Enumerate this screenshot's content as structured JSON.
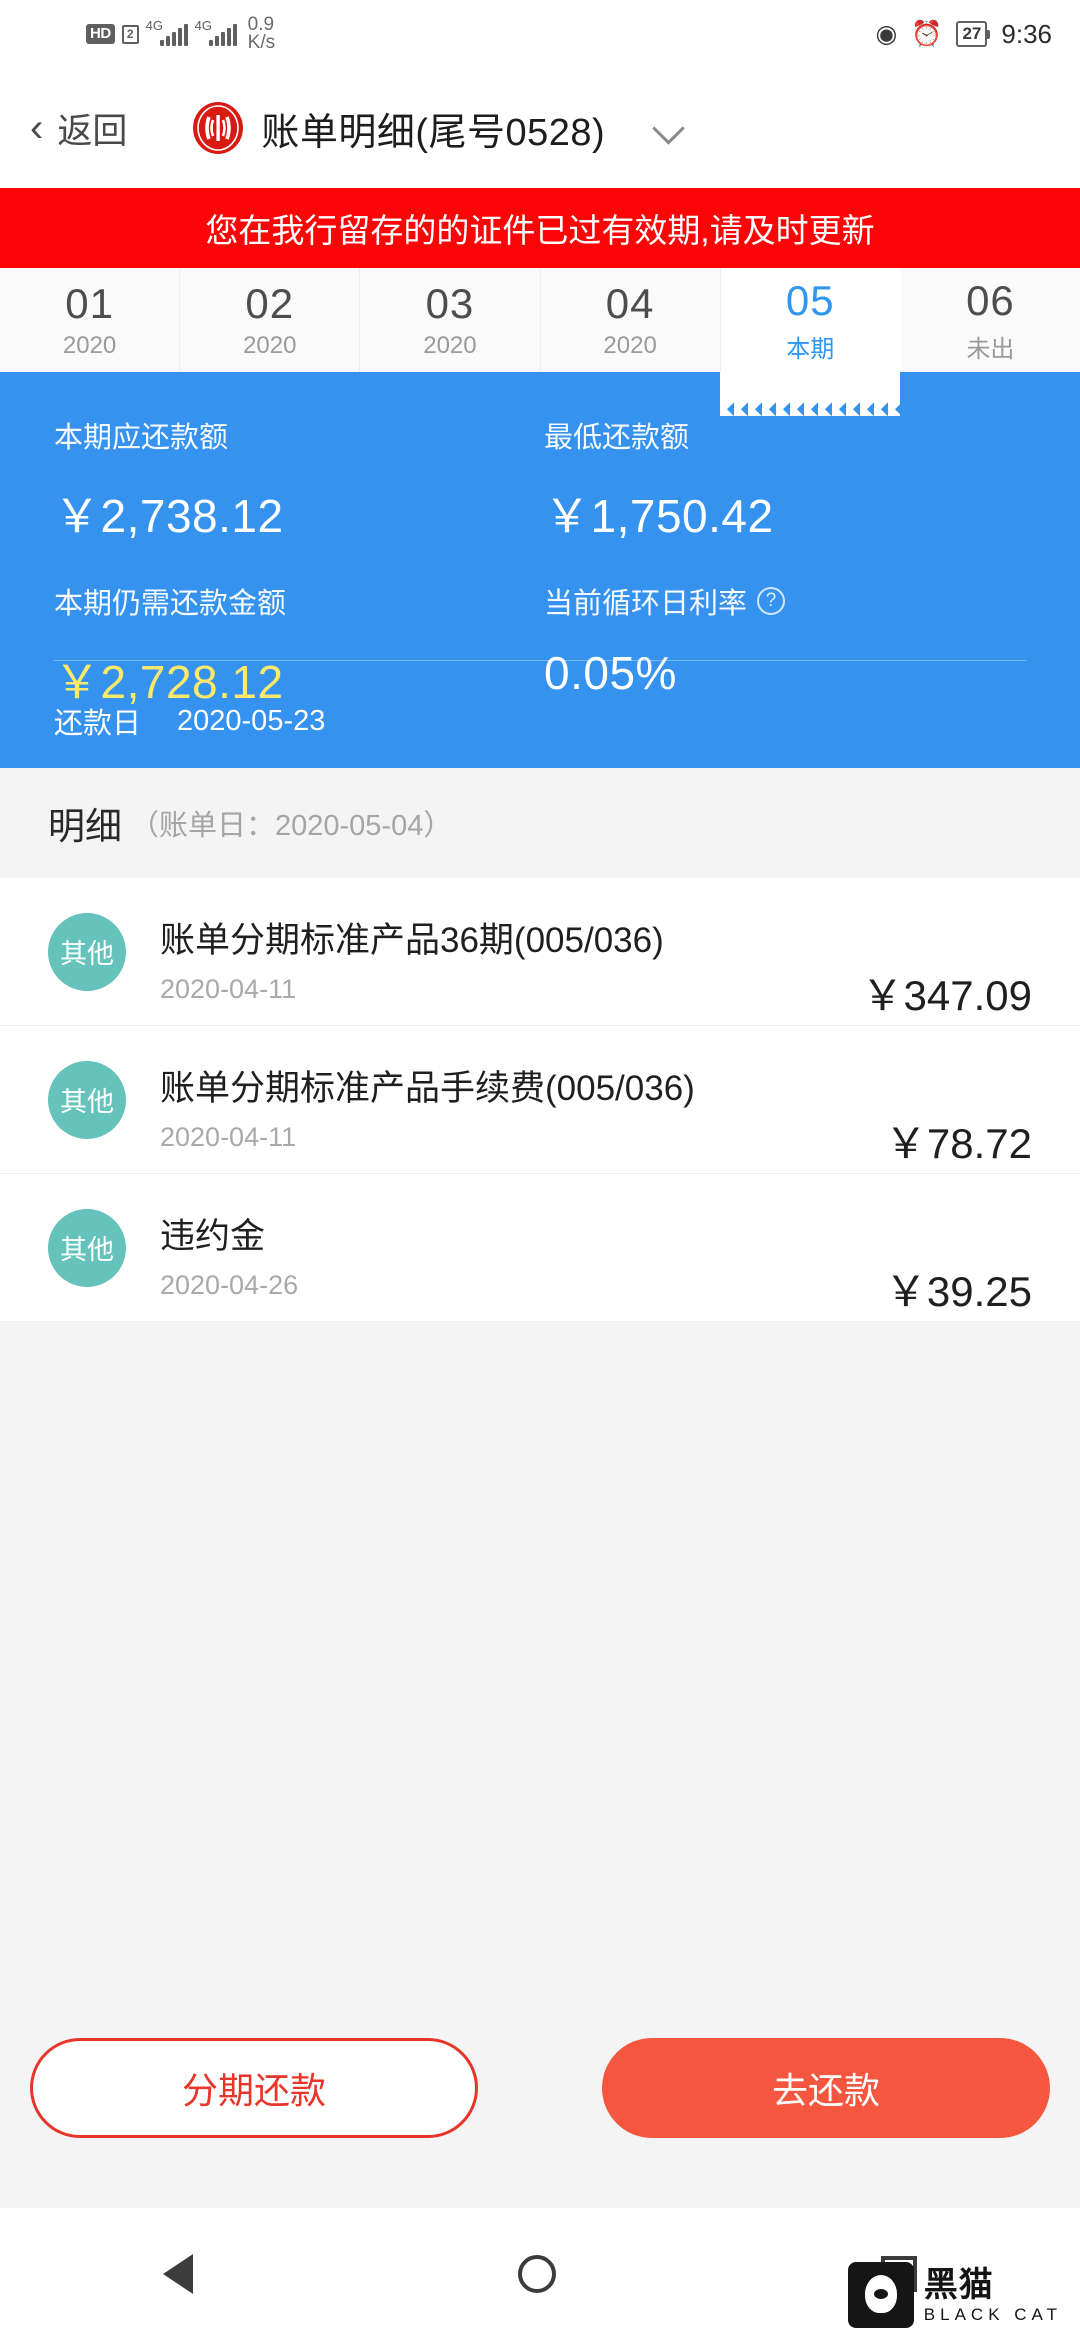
{
  "status_bar": {
    "hd_label": "HD",
    "sim_label": "2",
    "net_label_1": "4G",
    "net_label_2": "4G",
    "speed": "0.9",
    "speed_unit": "K/s",
    "eye_icon": "eye-icon",
    "alarm_icon": "alarm-icon",
    "battery": "27",
    "time": "9:36"
  },
  "navbar": {
    "back_label": "返回",
    "logo_name": "citic-bank-logo",
    "title": "账单明细(尾号0528)",
    "caret_icon": "chevron-down-icon"
  },
  "alert": {
    "text": "您在我行留存的的证件已过有效期,请及时更新",
    "background": "#fb0606"
  },
  "tabs": [
    {
      "month": "01",
      "sub": "2020",
      "active": false
    },
    {
      "month": "02",
      "sub": "2020",
      "active": false
    },
    {
      "month": "03",
      "sub": "2020",
      "active": false
    },
    {
      "month": "04",
      "sub": "2020",
      "active": false
    },
    {
      "month": "05",
      "sub": "本期",
      "active": true
    },
    {
      "month": "06",
      "sub": "未出",
      "active": false
    }
  ],
  "summary_card": {
    "accent": "#3592ef",
    "highlight_color": "#ffe96a",
    "due_label": "本期应还款额",
    "due_value": "￥2,738.12",
    "min_label": "最低还款额",
    "min_value": "￥1,750.42",
    "remaining_label": "本期仍需还款金额",
    "remaining_value": "￥2,728.12",
    "rate_label": "当前循环日利率",
    "rate_help_icon": "question-mark-icon",
    "rate_value": "0.05%",
    "repay_date_label": "还款日",
    "repay_date_value": "2020-05-23"
  },
  "detail_header": {
    "title": "明细",
    "subtitle": "（账单日：2020-05-04）"
  },
  "transactions": [
    {
      "badge": "其他",
      "title": "账单分期标准产品36期(005/036)",
      "date": "2020-04-11",
      "amount": "￥347.09"
    },
    {
      "badge": "其他",
      "title": "账单分期标准产品手续费(005/036)",
      "date": "2020-04-11",
      "amount": "￥78.72"
    },
    {
      "badge": "其他",
      "title": "违约金",
      "date": "2020-04-26",
      "amount": "￥39.25"
    }
  ],
  "actions": {
    "installment_label": "分期还款",
    "installment_color": "#e8352a",
    "repay_label": "去还款",
    "repay_color": "#f4563f"
  },
  "android_nav": {
    "back_icon": "triangle-back-icon",
    "home_icon": "circle-home-icon",
    "recent_icon": "square-recents-icon"
  },
  "watermark": {
    "cat_icon": "black-cat-logo",
    "line1": "黑猫",
    "line2": "BLACK CAT"
  }
}
